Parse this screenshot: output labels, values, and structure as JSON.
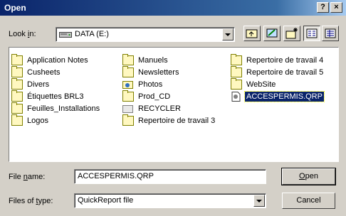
{
  "window": {
    "title": "Open",
    "help_label": "?",
    "close_label": "×"
  },
  "lookin": {
    "label_pre": "Look ",
    "label_ul": "i",
    "label_post": "n:",
    "value": "DATA (E:)"
  },
  "toolbar": {
    "icons": [
      "up-folder-icon",
      "desktop-icon",
      "new-folder-icon",
      "list-view-icon",
      "details-view-icon"
    ]
  },
  "files": [
    {
      "name": "Application Notes",
      "icon": "folder-icon"
    },
    {
      "name": "Cusheets",
      "icon": "folder-icon"
    },
    {
      "name": "Divers",
      "icon": "folder-icon"
    },
    {
      "name": "Étiquettes BRL3",
      "icon": "folder-icon"
    },
    {
      "name": "Feuilles_Installations",
      "icon": "folder-icon"
    },
    {
      "name": "Logos",
      "icon": "folder-icon"
    },
    {
      "name": "Manuels",
      "icon": "folder-icon"
    },
    {
      "name": "Newsletters",
      "icon": "folder-icon"
    },
    {
      "name": "Photos",
      "icon": "shared-folder-icon"
    },
    {
      "name": "Prod_CD",
      "icon": "folder-icon"
    },
    {
      "name": "RECYCLER",
      "icon": "recycle-folder-icon"
    },
    {
      "name": "Repertoire de travail 3",
      "icon": "folder-icon"
    },
    {
      "name": "Repertoire de travail 4",
      "icon": "folder-icon"
    },
    {
      "name": "Repertoire de travail 5",
      "icon": "folder-icon"
    },
    {
      "name": "WebSite",
      "icon": "folder-icon"
    },
    {
      "name": "ACCESPERMIS.QRP",
      "icon": "file-icon",
      "selected": true
    }
  ],
  "filename": {
    "label_pre": "File ",
    "label_ul": "n",
    "label_post": "ame:",
    "value": "ACCESPERMIS.QRP"
  },
  "filetype": {
    "label_pre": "Files of ",
    "label_ul": "t",
    "label_post": "ype:",
    "value": "QuickReport file"
  },
  "buttons": {
    "open_ul": "O",
    "open_rest": "pen",
    "cancel": "Cancel"
  },
  "colors": {
    "titlebar": "#0a246a",
    "face": "#d4d0c8",
    "selection": "#0a246a"
  }
}
